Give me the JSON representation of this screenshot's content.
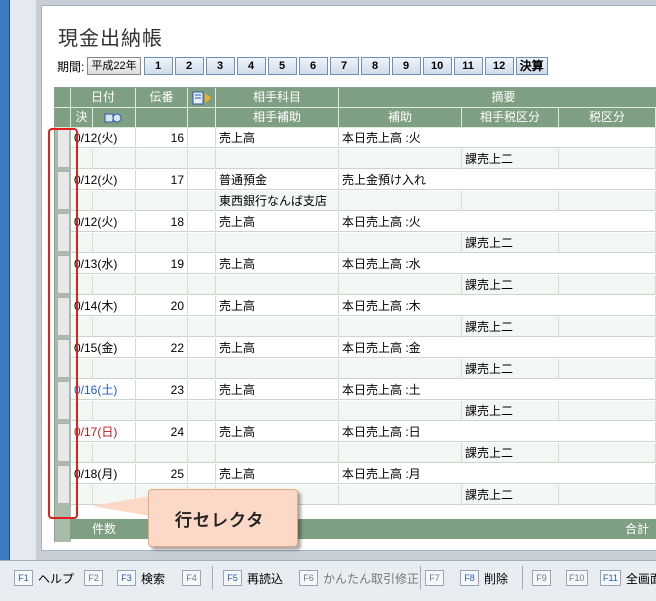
{
  "title": "現金出納帳",
  "period": {
    "label": "期間:",
    "year": "平成22年",
    "months": [
      "1",
      "2",
      "3",
      "4",
      "5",
      "6",
      "7",
      "8",
      "9",
      "10",
      "11",
      "12"
    ],
    "settlement": "決算"
  },
  "header": {
    "row1": {
      "date": "日付",
      "voucher": "伝番",
      "account": "相手科目",
      "summary": "摘要"
    },
    "row2": {
      "settle": "決",
      "sub_account": "相手補助",
      "aux": "補助",
      "partner_tax": "相手税区分",
      "tax": "税区分"
    }
  },
  "rows": [
    {
      "date": "0/12(火)",
      "no": "16",
      "account": "売上高",
      "summary": "本日売上高 :火",
      "tax2": "課売上二",
      "color": "normal"
    },
    {
      "date": "0/12(火)",
      "no": "17",
      "account": "普通預金",
      "summary": "売上金預け入れ",
      "sub": "東西銀行なんば支店",
      "tax2": "",
      "color": "normal"
    },
    {
      "date": "0/12(火)",
      "no": "18",
      "account": "売上高",
      "summary": "本日売上高 :火",
      "tax2": "課売上二",
      "color": "normal"
    },
    {
      "date": "0/13(水)",
      "no": "19",
      "account": "売上高",
      "summary": "本日売上高 :水",
      "tax2": "課売上二",
      "color": "normal"
    },
    {
      "date": "0/14(木)",
      "no": "20",
      "account": "売上高",
      "summary": "本日売上高 :木",
      "tax2": "課売上二",
      "color": "normal"
    },
    {
      "date": "0/15(金)",
      "no": "22",
      "account": "売上高",
      "summary": "本日売上高 :金",
      "tax2": "課売上二",
      "color": "normal"
    },
    {
      "date": "0/16(土)",
      "no": "23",
      "account": "売上高",
      "summary": "本日売上高 :土",
      "tax2": "課売上二",
      "color": "blue"
    },
    {
      "date": "0/17(日)",
      "no": "24",
      "account": "売上高",
      "summary": "本日売上高 :日",
      "tax2": "課売上二",
      "color": "red"
    },
    {
      "date": "0/18(月)",
      "no": "25",
      "account": "売上高",
      "summary": "本日売上高 :月",
      "tax2": "課売上二",
      "color": "normal"
    }
  ],
  "footer": {
    "count": "件数",
    "total": "合計"
  },
  "callout": "行セレクタ",
  "fkeys": [
    {
      "key": "F1",
      "label": "ヘルプ",
      "enabled": true
    },
    {
      "key": "F2",
      "label": "",
      "enabled": false
    },
    {
      "key": "F3",
      "label": "検索",
      "enabled": true
    },
    {
      "key": "F4",
      "label": "",
      "enabled": false
    },
    {
      "key": "F5",
      "label": "再読込",
      "enabled": true
    },
    {
      "key": "F6",
      "label": "かんたん取引修正",
      "enabled": false
    },
    {
      "key": "F7",
      "label": "",
      "enabled": false
    },
    {
      "key": "F8",
      "label": "削除",
      "enabled": true
    },
    {
      "key": "F9",
      "label": "",
      "enabled": false
    },
    {
      "key": "F10",
      "label": "",
      "enabled": false
    },
    {
      "key": "F11",
      "label": "全画面",
      "enabled": true
    }
  ]
}
